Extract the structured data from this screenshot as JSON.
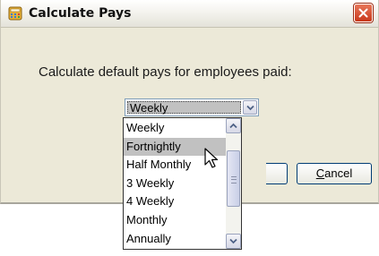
{
  "window": {
    "title": "Calculate Pays",
    "app_icon": "calculator-icon",
    "close_icon": "close-icon"
  },
  "prompt": "Calculate default pays for employees paid:",
  "pay_frequency": {
    "selected": "Weekly",
    "highlighted": "Fortnightly",
    "options": [
      "Weekly",
      "Fortnightly",
      "Half Monthly",
      "3 Weekly",
      "4 Weekly",
      "Monthly",
      "Annually"
    ]
  },
  "buttons": {
    "cancel_access": "C",
    "cancel_rest": "ancel"
  },
  "colors": {
    "dialog_bg": "#ece9d8",
    "selection": "#c1c1c1",
    "close_red": "#c8371a"
  }
}
